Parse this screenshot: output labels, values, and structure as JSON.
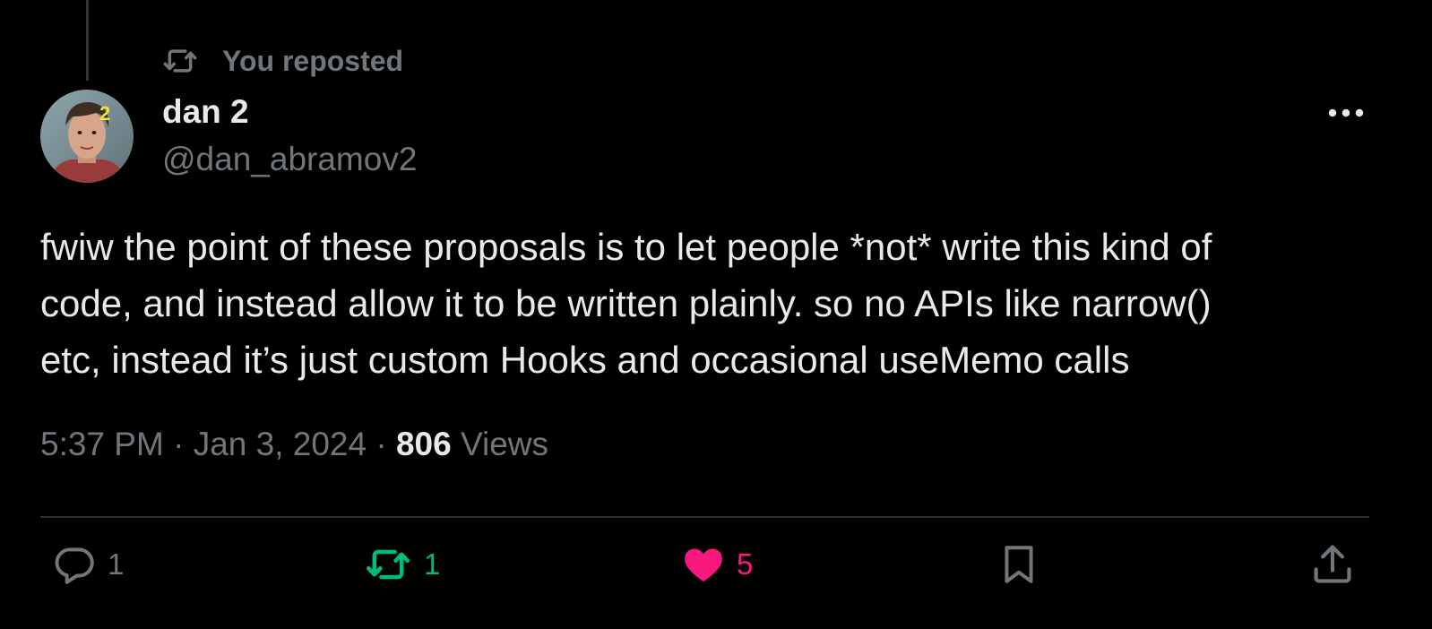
{
  "repost_banner": {
    "icon": "repost-icon",
    "text": "You reposted"
  },
  "author": {
    "display_name": "dan 2",
    "handle": "@dan_abramov2",
    "avatar_badge": "2"
  },
  "tweet": {
    "text": "fwiw the point of these proposals is to let people *not* write this kind of\ncode, and instead allow it to be written plainly. so no APIs like narrow()\netc, instead it’s just custom Hooks and occasional useMemo calls",
    "time": "5:37 PM",
    "separator": "·",
    "date": "Jan 3, 2024",
    "views_count": "806",
    "views_label": "Views"
  },
  "actions": {
    "reply": {
      "icon": "reply-icon",
      "count": "1"
    },
    "repost": {
      "icon": "repost-icon",
      "count": "1",
      "active": true,
      "color": "#00ba7c"
    },
    "like": {
      "icon": "heart-icon",
      "count": "5",
      "active": true,
      "color": "#f91880"
    },
    "bookmark": {
      "icon": "bookmark-icon"
    },
    "share": {
      "icon": "share-icon"
    }
  },
  "colors": {
    "background": "#000000",
    "primary_text": "#e7e9ea",
    "secondary_text": "#71767b",
    "divider": "#2f3336"
  }
}
